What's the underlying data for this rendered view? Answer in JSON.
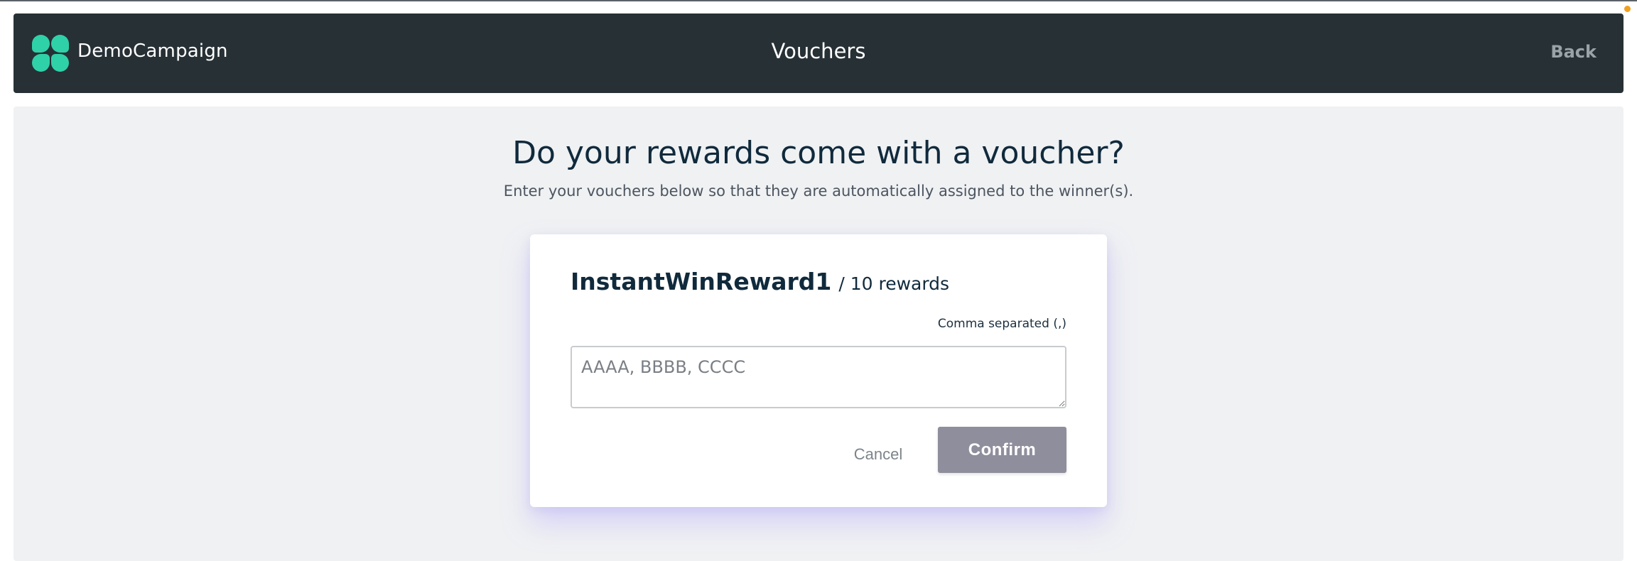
{
  "header": {
    "brand": "DemoCampaign",
    "title": "Vouchers",
    "back_label": "Back"
  },
  "main": {
    "headline": "Do your rewards come with a voucher?",
    "subline": "Enter your vouchers below so that they are automatically assigned to the winner(s)."
  },
  "card": {
    "reward_name": "InstantWinReward1",
    "reward_count": "/ 10 rewards",
    "hint": "Comma separated (,)",
    "input_placeholder": "AAAA, BBBB, CCCC",
    "input_value": "",
    "cancel_label": "Cancel",
    "confirm_label": "Confirm"
  },
  "colors": {
    "header_bg": "#273035",
    "accent": "#2fd1a8",
    "page_bg": "#f0f1f3",
    "confirm_bg": "#8f8e9c",
    "heading_text": "#102a3c"
  },
  "icons": {
    "logo": "clover-logo-icon"
  }
}
